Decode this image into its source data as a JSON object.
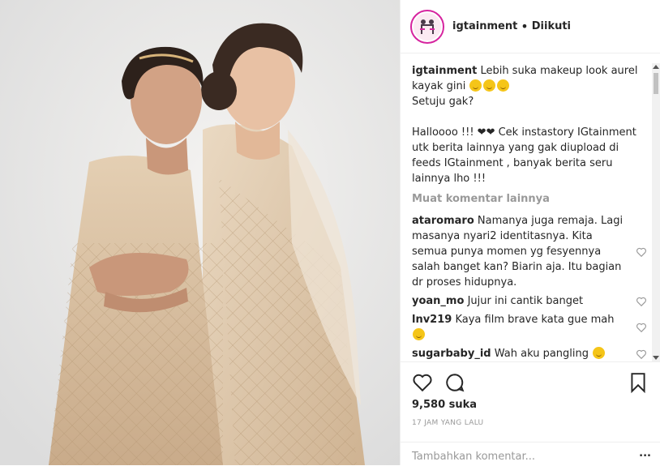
{
  "header": {
    "username": "igtainment",
    "separator": "•",
    "follow_status": "Diikuti"
  },
  "caption": {
    "username": "igtainment",
    "lines": [
      "Lebih suka makeup look aurel kayak gini",
      "Setuju gak?",
      "Halloooo !!! ❤❤ Cek instastory IGtainment utk berita lainnya yang gak diupload di feeds IGtainment , banyak berita seru lainnya lho !!!"
    ]
  },
  "load_more": "Muat komentar lainnya",
  "comments": [
    {
      "username": "ataromaro",
      "text": "Namanya juga remaja. Lagi masanya nyari2 identitasnya. Kita semua punya momen yg fesyennya salah banget kan? Biarin aja. Itu bagian dr proses hidupnya."
    },
    {
      "username": "yoan_mo",
      "text": "Jujur ini cantik banget"
    },
    {
      "username": "lnv219",
      "text": "Kaya film brave kata gue mah"
    },
    {
      "username": "sugarbaby_id",
      "text": "Wah aku pangling"
    }
  ],
  "likes": "9,580 suka",
  "timestamp": "17 JAM YANG LALU",
  "add_comment": {
    "placeholder": "Tambahkan komentar...",
    "more": "..."
  },
  "icons": [
    "heart-icon",
    "comment-icon",
    "bookmark-icon",
    "small-heart-icon"
  ],
  "colors": {
    "text": "#262626",
    "muted": "#999999",
    "border": "#efefef"
  }
}
